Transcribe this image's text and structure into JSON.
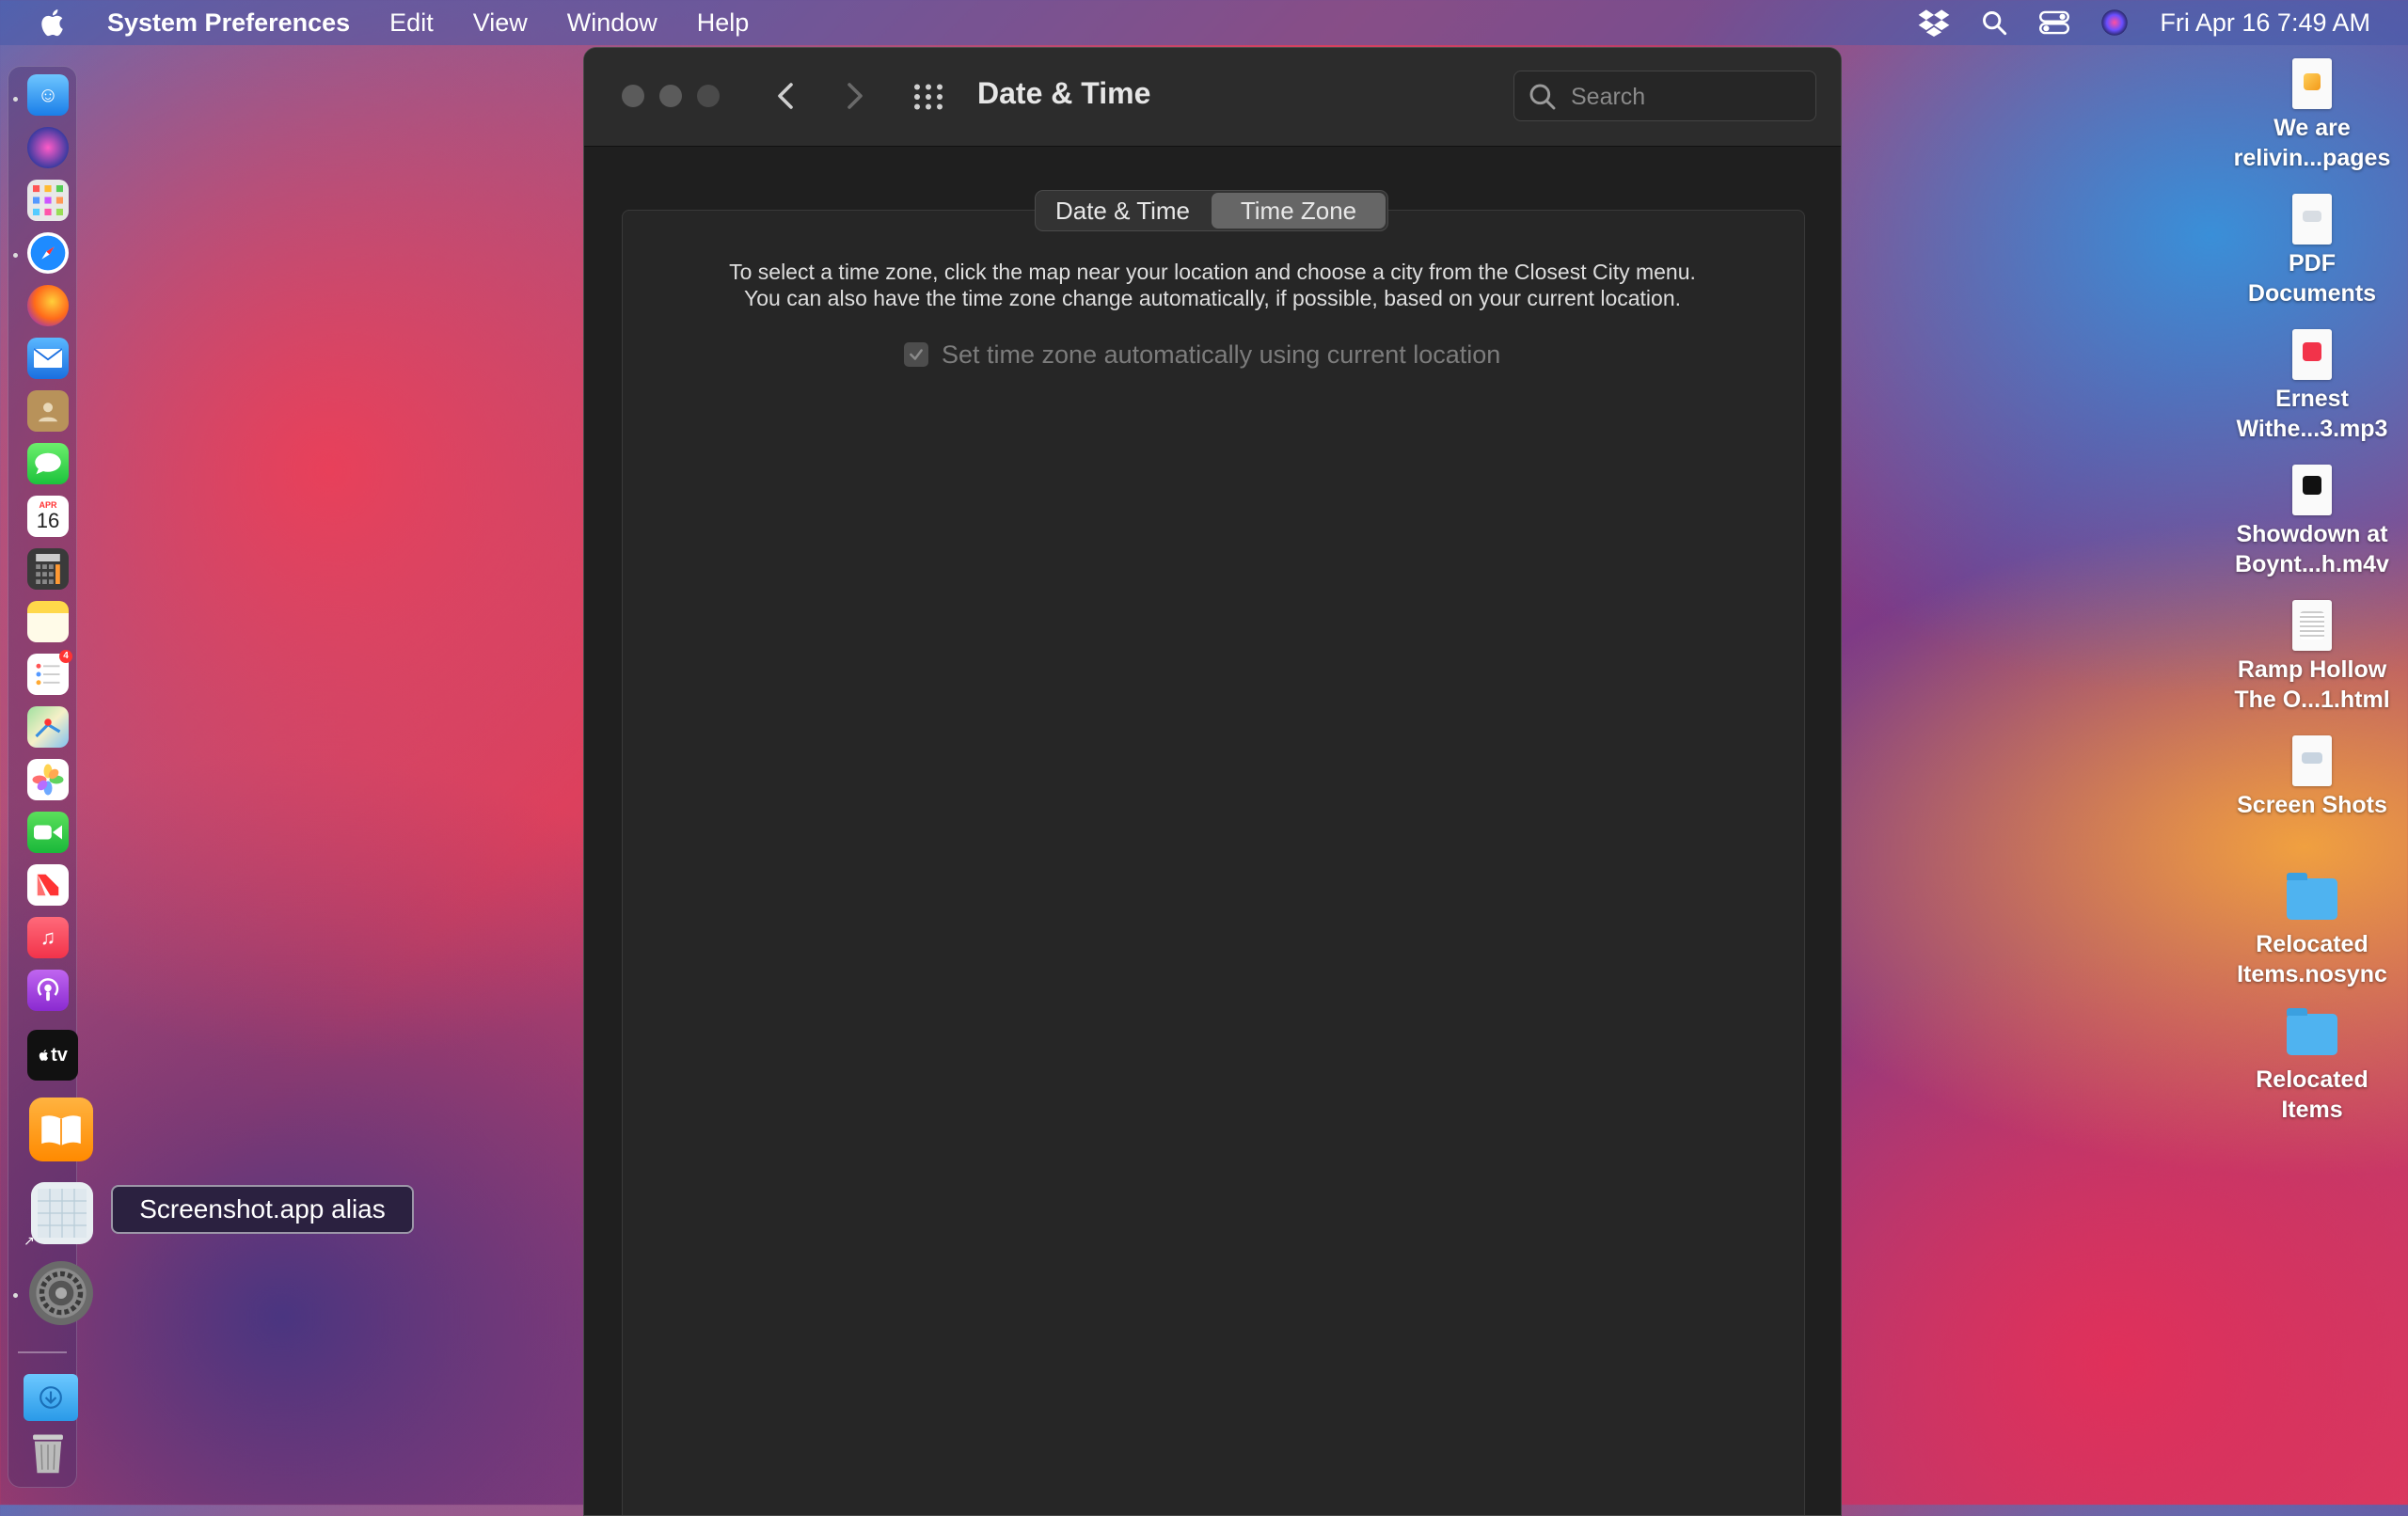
{
  "menubar": {
    "app_name": "System Preferences",
    "menus": [
      "Edit",
      "View",
      "Window",
      "Help"
    ],
    "clock": "Fri Apr 16  7:49 AM",
    "status_icons": [
      "dropbox-icon",
      "search-icon",
      "control-center-icon",
      "siri-icon"
    ]
  },
  "dock": {
    "items": [
      "finder",
      "siri",
      "launchpad",
      "safari",
      "firefox",
      "mail",
      "contacts",
      "messages",
      "calendar",
      "calculator",
      "notes",
      "reminders",
      "maps",
      "photos",
      "facetime",
      "news",
      "music",
      "podcasts",
      "tv",
      "books",
      "screenshot",
      "system-preferences",
      "downloads",
      "trash"
    ],
    "calendar_month": "APR",
    "calendar_day": "16",
    "reminders_badge": "4",
    "tv_label": "tv",
    "tooltip": "Screenshot.app alias"
  },
  "window": {
    "title": "Date & Time",
    "search_placeholder": "Search",
    "tabs": [
      {
        "label": "Date & Time",
        "active": false
      },
      {
        "label": "Time Zone",
        "active": true
      }
    ],
    "description_line1": "To select a time zone, click the map near your location and choose a city from the Closest City menu.",
    "description_line2": "You can also have the time zone change automatically, if possible, based on your current location.",
    "auto_timezone_label": "Set time zone automatically using current location",
    "auto_timezone_checked": true
  },
  "desktop": {
    "items": [
      {
        "line1": "We are",
        "line2": "relivin...pages",
        "kind": "doc"
      },
      {
        "line1": "PDF",
        "line2": "Documents",
        "kind": "doc"
      },
      {
        "line1": "Ernest",
        "line2": "Withe...3.mp3",
        "kind": "doc"
      },
      {
        "line1": "Showdown at",
        "line2": "Boynt...h.m4v",
        "kind": "doc"
      },
      {
        "line1": "Ramp Hollow",
        "line2": "The O...1.html",
        "kind": "doc"
      },
      {
        "line1": "Screen Shots",
        "line2": "",
        "kind": "doc"
      },
      {
        "line1": "Relocated",
        "line2": "Items.nosync",
        "kind": "folder"
      },
      {
        "line1": "Relocated",
        "line2": "Items",
        "kind": "folder"
      }
    ]
  }
}
